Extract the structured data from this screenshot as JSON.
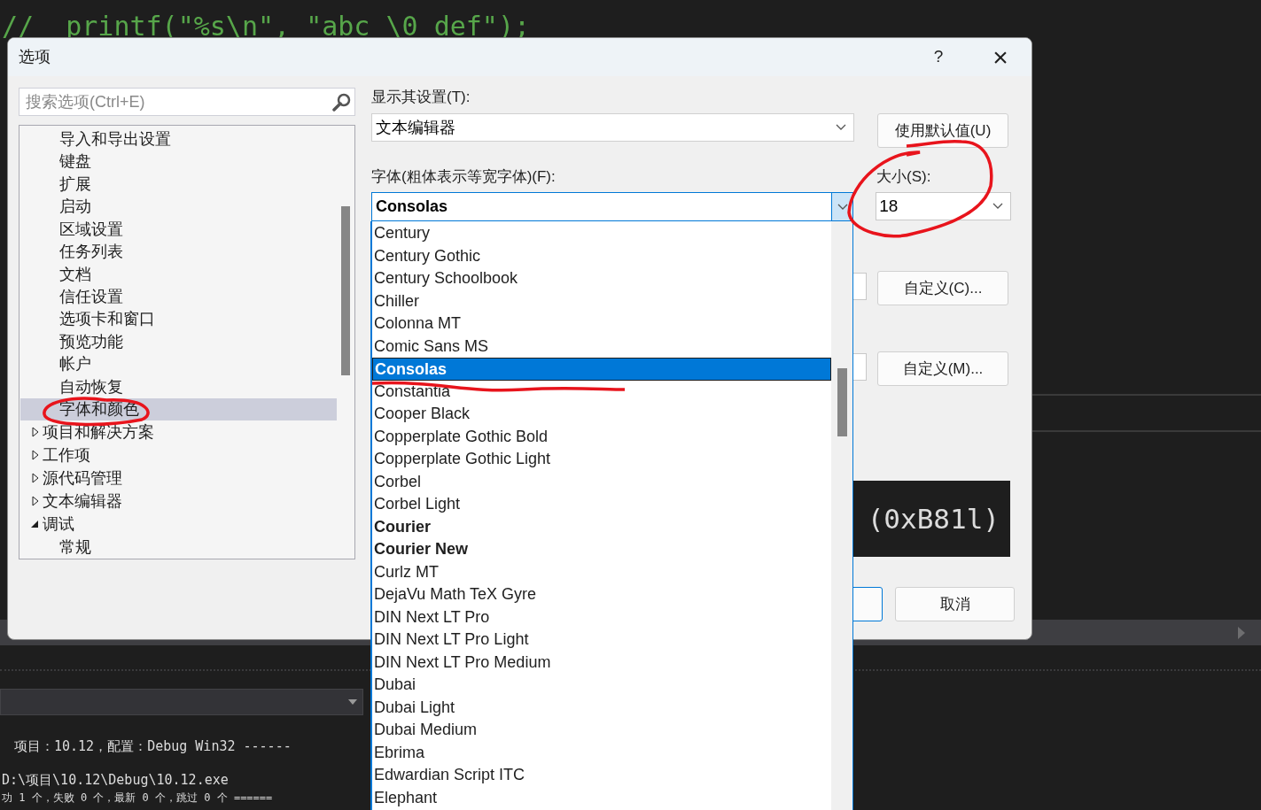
{
  "editor": {
    "code_line": "//  printf(\"%s\\n\", \"abc \\0 def\");"
  },
  "dialog": {
    "title": "选项",
    "help": "?",
    "close": "×",
    "search": {
      "placeholder": "搜索选项(Ctrl+E)"
    },
    "tree": {
      "continued_children": [
        {
          "label": "导入和导出设置",
          "selected": false
        },
        {
          "label": "键盘",
          "selected": false
        },
        {
          "label": "扩展",
          "selected": false
        },
        {
          "label": "启动",
          "selected": false
        },
        {
          "label": "区域设置",
          "selected": false
        },
        {
          "label": "任务列表",
          "selected": false
        },
        {
          "label": "文档",
          "selected": false
        },
        {
          "label": "信任设置",
          "selected": false
        },
        {
          "label": "选项卡和窗口",
          "selected": false
        },
        {
          "label": "预览功能",
          "selected": false
        },
        {
          "label": "帐户",
          "selected": false
        },
        {
          "label": "自动恢复",
          "selected": false
        },
        {
          "label": "字体和颜色",
          "selected": true
        }
      ],
      "items": [
        {
          "label": "项目和解决方案",
          "expanded": false,
          "selected": false
        },
        {
          "label": "工作项",
          "expanded": false,
          "selected": false
        },
        {
          "label": "源代码管理",
          "expanded": false,
          "selected": false
        },
        {
          "label": "文本编辑器",
          "expanded": false,
          "selected": false
        },
        {
          "label": "调试",
          "expanded": true,
          "selected": false,
          "children": [
            {
              "label": "常规",
              "selected": false
            }
          ]
        }
      ]
    },
    "show_settings_for": {
      "label": "显示其设置(T):",
      "value": "文本编辑器"
    },
    "use_defaults_button": "使用默认值(U)",
    "font": {
      "label": "字体(粗体表示等宽字体)(F):",
      "value": "Consolas",
      "expanded": true
    },
    "size": {
      "label": "大小(S):",
      "value": "18"
    },
    "customize_item_button": "自定义(C)...",
    "customize_more_button": "自定义(M)...",
    "preview": {
      "sample": "(0xB81l)"
    },
    "cancel_button": "取消"
  },
  "font_list": [
    {
      "label": "Century",
      "bold": false,
      "selected": false
    },
    {
      "label": "Century Gothic",
      "bold": false,
      "selected": false
    },
    {
      "label": "Century Schoolbook",
      "bold": false,
      "selected": false
    },
    {
      "label": "Chiller",
      "bold": false,
      "selected": false
    },
    {
      "label": "Colonna MT",
      "bold": false,
      "selected": false
    },
    {
      "label": "Comic Sans MS",
      "bold": false,
      "selected": false
    },
    {
      "label": "Consolas",
      "bold": true,
      "selected": true
    },
    {
      "label": "Constantia",
      "bold": false,
      "selected": false
    },
    {
      "label": "Cooper Black",
      "bold": false,
      "selected": false
    },
    {
      "label": "Copperplate Gothic Bold",
      "bold": false,
      "selected": false
    },
    {
      "label": "Copperplate Gothic Light",
      "bold": false,
      "selected": false
    },
    {
      "label": "Corbel",
      "bold": false,
      "selected": false
    },
    {
      "label": "Corbel Light",
      "bold": false,
      "selected": false
    },
    {
      "label": "Courier",
      "bold": true,
      "selected": false
    },
    {
      "label": "Courier New",
      "bold": true,
      "selected": false
    },
    {
      "label": "Curlz MT",
      "bold": false,
      "selected": false
    },
    {
      "label": "DejaVu Math TeX Gyre",
      "bold": false,
      "selected": false
    },
    {
      "label": "DIN Next LT Pro",
      "bold": false,
      "selected": false
    },
    {
      "label": "DIN Next LT Pro Light",
      "bold": false,
      "selected": false
    },
    {
      "label": "DIN Next LT Pro Medium",
      "bold": false,
      "selected": false
    },
    {
      "label": "Dubai",
      "bold": false,
      "selected": false
    },
    {
      "label": "Dubai Light",
      "bold": false,
      "selected": false
    },
    {
      "label": "Dubai Medium",
      "bold": false,
      "selected": false
    },
    {
      "label": "Ebrima",
      "bold": false,
      "selected": false
    },
    {
      "label": "Edwardian Script ITC",
      "bold": false,
      "selected": false
    },
    {
      "label": "Elephant",
      "bold": false,
      "selected": false
    }
  ],
  "output": {
    "lines": [
      "项目：10.12，配置：Debug Win32 ------",
      "D:\\项目\\10.12\\Debug\\10.12.exe",
      "功 1 个，失败 0 个，最新 0 个，跳过 0 个 ======"
    ]
  }
}
